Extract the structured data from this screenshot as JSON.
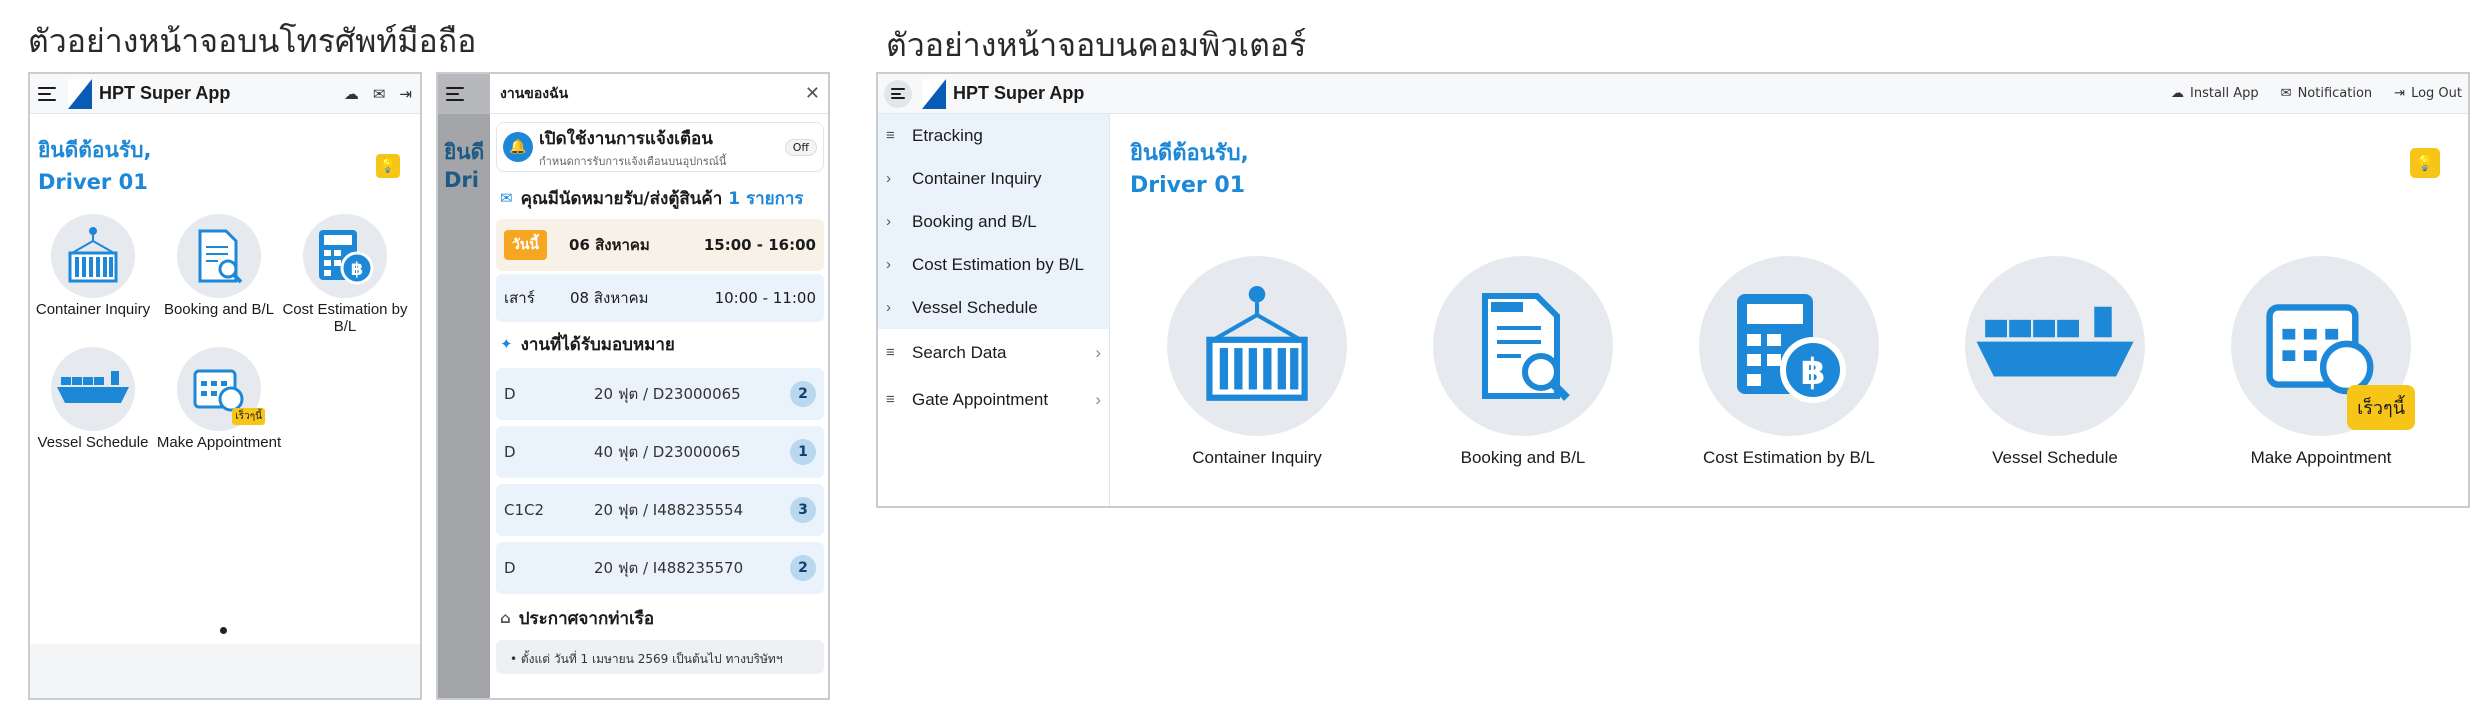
{
  "captions": {
    "mobile": "ตัวอย่างหน้าจอบนโทรศัพท์มือถือ",
    "desktop": "ตัวอย่างหน้าจอบนคอมพิวเตอร์"
  },
  "app": {
    "title": "HPT Super App",
    "welcome_line1": "ยินดีต้อนรับ,",
    "welcome_line2": "Driver 01"
  },
  "mobile_tiles": [
    {
      "label": "Container Inquiry",
      "icon": "container-crane-icon"
    },
    {
      "label": "Booking and B/L",
      "icon": "booking-document-icon"
    },
    {
      "label": "Cost Estimation by B/L",
      "icon": "calculator-baht-icon"
    },
    {
      "label": "Vessel Schedule",
      "icon": "vessel-icon"
    },
    {
      "label": "Make Appointment",
      "icon": "calendar-clock-icon"
    }
  ],
  "soon_badge": "เร็วๆนี้",
  "drawer": {
    "title": "งานของฉัน",
    "dim_welcome_1": "ยินดี",
    "dim_welcome_2": "Dri",
    "notification": {
      "title": "เปิดใช้งานการแจ้งเตือน",
      "subtitle": "กำหนดการรับการแจ้งเตือนบนอุปกรณ์นี้",
      "toggle": "Off"
    },
    "appointments_heading": "คุณมีนัดหมายรับ/ส่งตู้สินค้า",
    "appointments_count": "1 รายการ",
    "appointments": [
      {
        "day": "วันนี้",
        "date": "06 สิงหาคม",
        "time": "15:00 - 16:00"
      },
      {
        "day": "เสาร์",
        "date": "08 สิงหาคม",
        "time": "10:00 - 11:00"
      }
    ],
    "jobs_heading": "งานที่ได้รับมอบหมาย",
    "jobs": [
      {
        "type": "D",
        "detail": "20 ฟุต / D23000065",
        "count": "2"
      },
      {
        "type": "D",
        "detail": "40 ฟุต / D23000065",
        "count": "1"
      },
      {
        "type": "C1C2",
        "detail": "20 ฟุต / I488235554",
        "count": "3"
      },
      {
        "type": "D",
        "detail": "20 ฟุต / I488235570",
        "count": "2"
      }
    ],
    "announce_heading": "ประกาศจากท่าเรือ",
    "announce_text": "• ตั้งแต่ วันที่ 1 เมษายน 2569 เป็นต้นไป ทางบริษัทฯ"
  },
  "desktop": {
    "actions": {
      "install": "Install App",
      "notification": "Notification",
      "logout": "Log Out"
    },
    "sidebar": {
      "etracking": "Etracking",
      "etracking_items": [
        "Container Inquiry",
        "Booking and B/L",
        "Cost Estimation by B/L",
        "Vessel Schedule"
      ],
      "search_data": "Search Data",
      "gate_appointment": "Gate Appointment"
    },
    "tiles": [
      {
        "label": "Container Inquiry"
      },
      {
        "label": "Booking and B/L"
      },
      {
        "label": "Cost Estimation by B/L"
      },
      {
        "label": "Vessel Schedule"
      },
      {
        "label": "Make Appointment"
      }
    ]
  },
  "colors": {
    "accent": "#1e88d8",
    "badge": "#f7c518",
    "today": "#f6a623",
    "brand": "#0a5bb5"
  }
}
